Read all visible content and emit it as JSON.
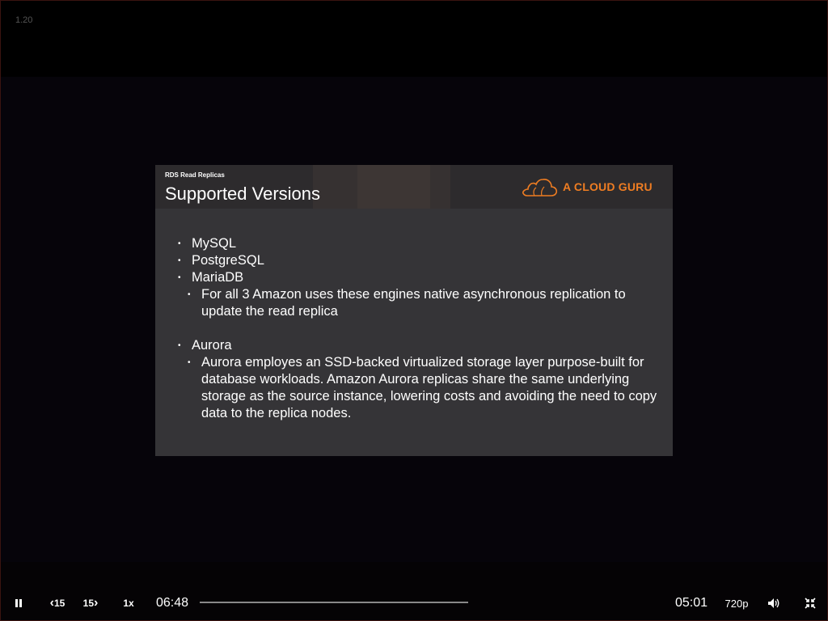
{
  "player": {
    "version": "1.20",
    "current_time": "06:48",
    "remaining_time": "05:01",
    "speed": "1x",
    "quality": "720p",
    "rewind_label": "15",
    "forward_label": "15",
    "progress": 0.0
  },
  "slide": {
    "subtitle": "RDS Read Replicas",
    "title": "Supported Versions",
    "brand": "A CLOUD GURU",
    "brand_color": "#ef7d22",
    "bullets": [
      "MySQL",
      "PostgreSQL",
      "MariaDB",
      "For all 3 Amazon uses these engines native asynchronous replication to update the read replica",
      "Aurora",
      "Aurora employes an SSD-backed virtualized storage layer purpose-built for database workloads. Amazon Aurora replicas share the same underlying storage as the source instance, lowering costs and avoiding the need to copy data to the replica nodes."
    ]
  }
}
